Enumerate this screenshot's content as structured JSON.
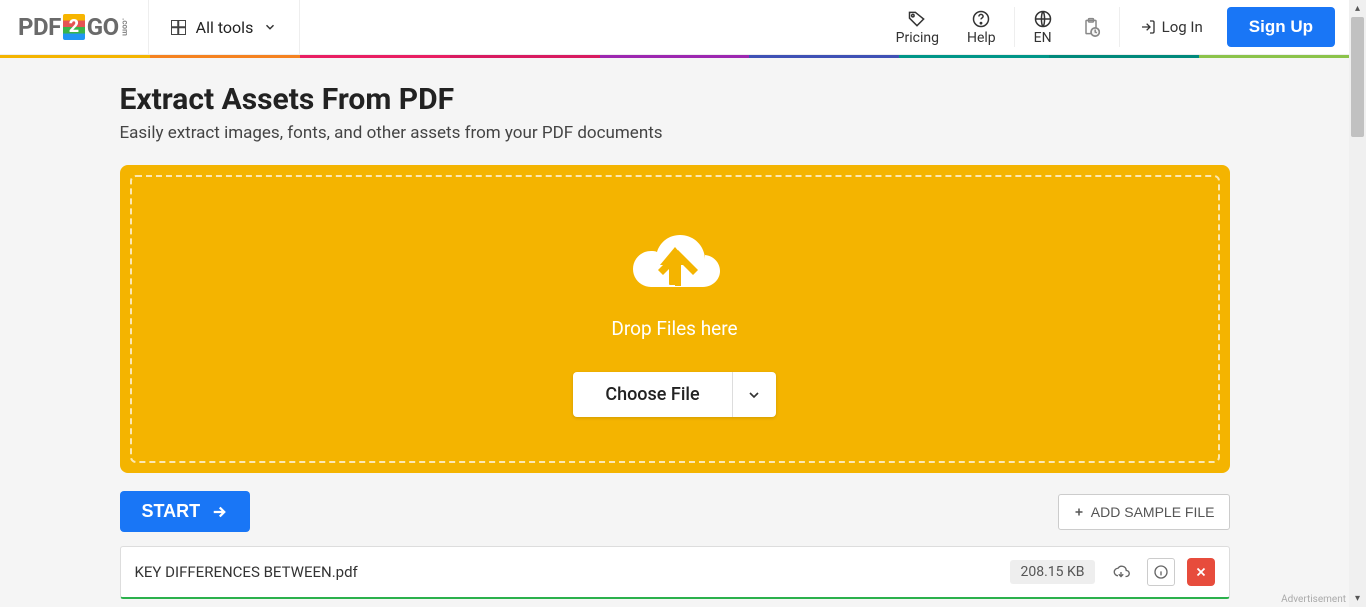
{
  "header": {
    "logo_pdf": "PDF",
    "logo_2": "2",
    "logo_go": "GO",
    "logo_com": ".com",
    "all_tools_label": "All tools",
    "pricing_label": "Pricing",
    "help_label": "Help",
    "lang_label": "EN",
    "login_label": "Log In",
    "signup_label": "Sign Up"
  },
  "rainbow_colors": [
    "#f4b400",
    "#f58220",
    "#e91e63",
    "#d81b60",
    "#9c27b0",
    "#3f51b5",
    "#009688",
    "#00897b",
    "#8bc34a"
  ],
  "page": {
    "title": "Extract Assets From PDF",
    "subtitle": "Easily extract images, fonts, and other assets from your PDF documents"
  },
  "dropzone": {
    "drop_text": "Drop Files here",
    "choose_file_label": "Choose File"
  },
  "actions": {
    "start_label": "START",
    "sample_label": "ADD SAMPLE FILE"
  },
  "file": {
    "name": "KEY DIFFERENCES BETWEEN.pdf",
    "size": "208.15 KB"
  },
  "footer": {
    "ad_label": "Advertisement"
  }
}
